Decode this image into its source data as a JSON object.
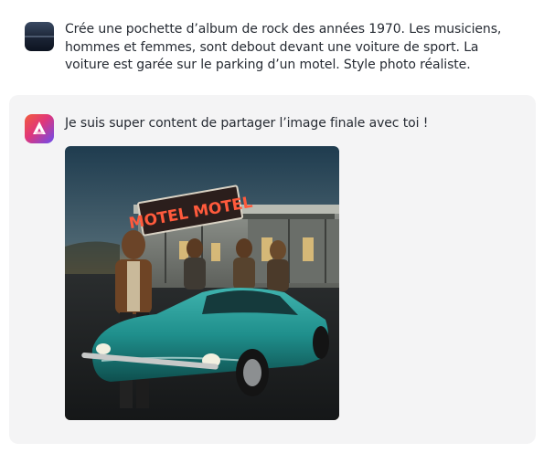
{
  "user_message": {
    "text": "Crée une pochette d’album de rock des années 1970. Les musiciens, hommes et femmes, sont debout devant une voiture de sport. La voiture est garée sur le parking d’un motel. Style photo réaliste."
  },
  "assistant_message": {
    "text": "Je suis super content de partager l’image finale avec toi !",
    "image": {
      "sign_text": "MOTEL MOTEL",
      "sign_color": "#ff5a3c",
      "car_color": "#1f8f8c"
    }
  }
}
